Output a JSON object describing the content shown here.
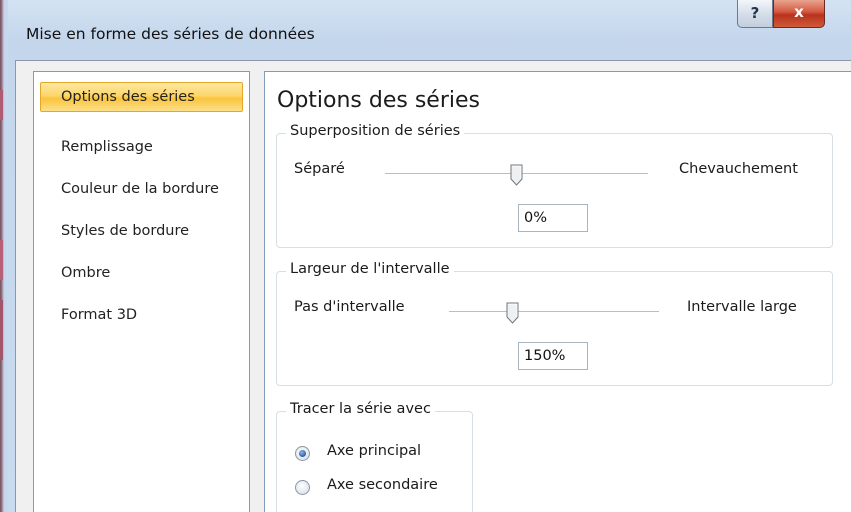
{
  "dialog": {
    "title": "Mise en forme des séries de données",
    "help_button": "?",
    "close_button": "x"
  },
  "sidebar": {
    "items": [
      {
        "label": "Options des séries",
        "selected": true
      },
      {
        "label": "Remplissage",
        "selected": false
      },
      {
        "label": "Couleur de la bordure",
        "selected": false
      },
      {
        "label": "Styles de bordure",
        "selected": false
      },
      {
        "label": "Ombre",
        "selected": false
      },
      {
        "label": "Format 3D",
        "selected": false
      }
    ]
  },
  "panel": {
    "title": "Options des séries",
    "overlap": {
      "legend": "Superposition de séries",
      "left_label": "Séparé",
      "right_label": "Chevauchement",
      "value": "0%",
      "slider_position": 0.5
    },
    "gap_width": {
      "legend": "Largeur de l'intervalle",
      "left_label": "Pas d'intervalle",
      "right_label": "Intervalle large",
      "value": "150%",
      "slider_position": 0.3
    },
    "plot_on": {
      "legend": "Tracer la série avec",
      "options": [
        {
          "label": "Axe principal",
          "checked": true
        },
        {
          "label": "Axe secondaire",
          "checked": false
        }
      ]
    }
  },
  "colors": {
    "selected_item": "#fcd66c",
    "close_button": "#c8452b",
    "title_bar": "#c9dbef"
  }
}
